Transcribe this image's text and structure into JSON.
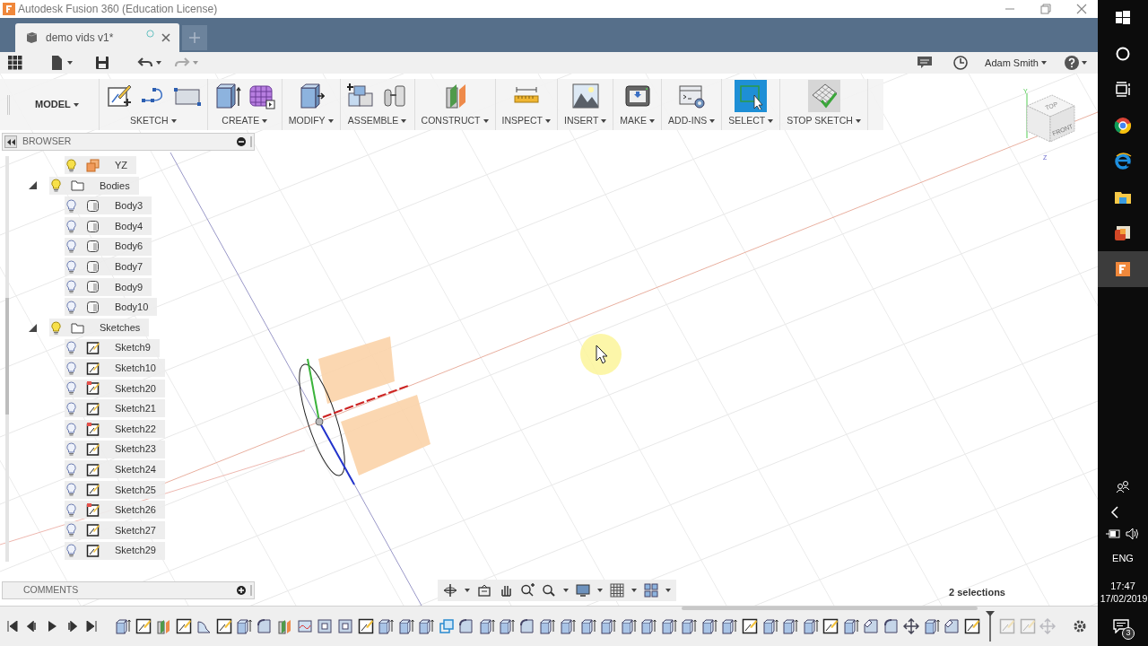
{
  "window": {
    "title": "Autodesk Fusion 360 (Education License)"
  },
  "tabs": [
    {
      "label": "demo vids v1*",
      "selected": true
    }
  ],
  "user": {
    "name": "Adam Smith"
  },
  "workspace": {
    "label": "MODEL"
  },
  "toolbar_groups": [
    {
      "label": "SKETCH",
      "active": false,
      "tools": [
        {
          "kind": "sketch"
        },
        {
          "kind": "spline"
        },
        {
          "kind": "rectangle"
        }
      ]
    },
    {
      "label": "CREATE",
      "active": false,
      "tools": [
        {
          "kind": "extrude"
        },
        {
          "kind": "form"
        }
      ]
    },
    {
      "label": "MODIFY",
      "active": false,
      "tools": [
        {
          "kind": "presspull"
        }
      ]
    },
    {
      "label": "ASSEMBLE",
      "active": false,
      "tools": [
        {
          "kind": "component"
        },
        {
          "kind": "joint"
        }
      ]
    },
    {
      "label": "CONSTRUCT",
      "active": false,
      "tools": [
        {
          "kind": "plane"
        }
      ]
    },
    {
      "label": "INSPECT",
      "active": false,
      "tools": [
        {
          "kind": "measure"
        }
      ]
    },
    {
      "label": "INSERT",
      "active": false,
      "tools": [
        {
          "kind": "image"
        }
      ]
    },
    {
      "label": "MAKE",
      "active": false,
      "tools": [
        {
          "kind": "printer"
        }
      ]
    },
    {
      "label": "ADD-INS",
      "active": false,
      "tools": [
        {
          "kind": "scripts"
        }
      ]
    },
    {
      "label": "SELECT",
      "active": true,
      "tools": [
        {
          "kind": "select"
        }
      ]
    },
    {
      "label": "STOP SKETCH",
      "active": false,
      "tools": [
        {
          "kind": "stop"
        }
      ]
    }
  ],
  "browser": {
    "title": "BROWSER",
    "items": [
      {
        "label": "YZ",
        "kind": "plane"
      },
      {
        "label": "Bodies",
        "kind": "folder",
        "expanded": true,
        "children": [
          {
            "label": "Body3",
            "kind": "body"
          },
          {
            "label": "Body4",
            "kind": "body"
          },
          {
            "label": "Body6",
            "kind": "body"
          },
          {
            "label": "Body7",
            "kind": "body"
          },
          {
            "label": "Body9",
            "kind": "body"
          },
          {
            "label": "Body10",
            "kind": "body"
          }
        ]
      },
      {
        "label": "Sketches",
        "kind": "folder",
        "expanded": true,
        "children": [
          {
            "label": "Sketch9",
            "kind": "sketch",
            "warning": false
          },
          {
            "label": "Sketch10",
            "kind": "sketch",
            "warning": false
          },
          {
            "label": "Sketch20",
            "kind": "sketch",
            "warning": true
          },
          {
            "label": "Sketch21",
            "kind": "sketch",
            "warning": false
          },
          {
            "label": "Sketch22",
            "kind": "sketch",
            "warning": true
          },
          {
            "label": "Sketch23",
            "kind": "sketch",
            "warning": false
          },
          {
            "label": "Sketch24",
            "kind": "sketch",
            "warning": false
          },
          {
            "label": "Sketch25",
            "kind": "sketch",
            "warning": false
          },
          {
            "label": "Sketch26",
            "kind": "sketch",
            "warning": true
          },
          {
            "label": "Sketch27",
            "kind": "sketch",
            "warning": false
          },
          {
            "label": "Sketch29",
            "kind": "sketch",
            "warning": false
          }
        ]
      }
    ]
  },
  "comments": {
    "title": "COMMENTS"
  },
  "viewcube": {
    "top": "TOP",
    "front": "FRONT",
    "axis_labels": [
      "Y",
      "Z"
    ]
  },
  "status": "2 selections",
  "timeline": [
    {
      "kind": "extrude",
      "rolled_back": false
    },
    {
      "kind": "sketch",
      "rolled_back": false
    },
    {
      "kind": "plane",
      "rolled_back": false
    },
    {
      "kind": "sketch",
      "rolled_back": false
    },
    {
      "kind": "revolve",
      "rolled_back": false
    },
    {
      "kind": "sketch",
      "rolled_back": false
    },
    {
      "kind": "extrude",
      "rolled_back": false
    },
    {
      "kind": "fillet",
      "rolled_back": false
    },
    {
      "kind": "plane",
      "rolled_back": false
    },
    {
      "kind": "surface",
      "rolled_back": false
    },
    {
      "kind": "shell",
      "rolled_back": false
    },
    {
      "kind": "shell",
      "rolled_back": false
    },
    {
      "kind": "sketch",
      "rolled_back": false
    },
    {
      "kind": "extrude",
      "rolled_back": false
    },
    {
      "kind": "extrude",
      "rolled_back": false
    },
    {
      "kind": "extrude",
      "rolled_back": false
    },
    {
      "kind": "combine",
      "rolled_back": false
    },
    {
      "kind": "fillet",
      "rolled_back": false
    },
    {
      "kind": "extrude",
      "rolled_back": false
    },
    {
      "kind": "extrude",
      "rolled_back": false
    },
    {
      "kind": "fillet",
      "rolled_back": false
    },
    {
      "kind": "extrude",
      "rolled_back": false
    },
    {
      "kind": "extrude",
      "rolled_back": false
    },
    {
      "kind": "extrude",
      "rolled_back": false
    },
    {
      "kind": "extrude",
      "rolled_back": false
    },
    {
      "kind": "extrude",
      "rolled_back": false
    },
    {
      "kind": "extrude",
      "rolled_back": false
    },
    {
      "kind": "extrude",
      "rolled_back": false
    },
    {
      "kind": "extrude",
      "rolled_back": false
    },
    {
      "kind": "extrude",
      "rolled_back": false
    },
    {
      "kind": "extrude",
      "rolled_back": false
    },
    {
      "kind": "sketch",
      "rolled_back": false
    },
    {
      "kind": "extrude",
      "rolled_back": false
    },
    {
      "kind": "extrude",
      "rolled_back": false
    },
    {
      "kind": "extrude",
      "rolled_back": false
    },
    {
      "kind": "sketch",
      "rolled_back": false
    },
    {
      "kind": "extrude",
      "rolled_back": false
    },
    {
      "kind": "chamfer",
      "rolled_back": false
    },
    {
      "kind": "fillet",
      "rolled_back": false
    },
    {
      "kind": "move",
      "rolled_back": false
    },
    {
      "kind": "extrude",
      "rolled_back": false
    },
    {
      "kind": "chamfer",
      "rolled_back": false
    },
    {
      "kind": "sketch",
      "rolled_back": false
    },
    {
      "kind": "sketch",
      "rolled_back": true
    },
    {
      "kind": "sketch",
      "rolled_back": true
    },
    {
      "kind": "move",
      "rolled_back": true
    }
  ],
  "taskbar": {
    "apps": [
      {
        "kind": "start",
        "selected": false
      },
      {
        "kind": "search",
        "selected": false
      },
      {
        "kind": "taskview",
        "selected": false
      },
      {
        "kind": "chrome",
        "selected": false
      },
      {
        "kind": "edge",
        "selected": false
      },
      {
        "kind": "explorer",
        "selected": false
      },
      {
        "kind": "slides",
        "selected": false
      },
      {
        "kind": "fusion",
        "selected": true
      }
    ],
    "language": "ENG",
    "time": "17:47",
    "date": "17/02/2019",
    "notifications": "3"
  }
}
